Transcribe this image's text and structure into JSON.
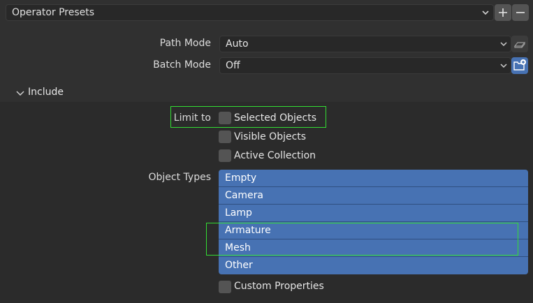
{
  "presets": {
    "label": "Operator Presets",
    "add_label": "+",
    "remove_label": "−"
  },
  "path_mode": {
    "label": "Path Mode",
    "value": "Auto"
  },
  "batch_mode": {
    "label": "Batch Mode",
    "value": "Off"
  },
  "include": {
    "label": "Include",
    "limit_to_label": "Limit to",
    "checkboxes": [
      {
        "label": "Selected Objects",
        "checked": false
      },
      {
        "label": "Visible Objects",
        "checked": false
      },
      {
        "label": "Active Collection",
        "checked": false
      }
    ],
    "object_types_label": "Object Types",
    "object_types": [
      "Empty",
      "Camera",
      "Lamp",
      "Armature",
      "Mesh",
      "Other"
    ],
    "custom_properties": {
      "label": "Custom Properties",
      "checked": false
    }
  },
  "colors": {
    "accent": "#4772b3",
    "highlight": "#33dd33",
    "background": "#303030"
  },
  "icons": {
    "preset_dropdown": "chevron-down-icon",
    "path_mode_side": "eraser-icon",
    "batch_mode_side": "new-folder-icon",
    "include_toggle": "chevron-down-icon"
  }
}
